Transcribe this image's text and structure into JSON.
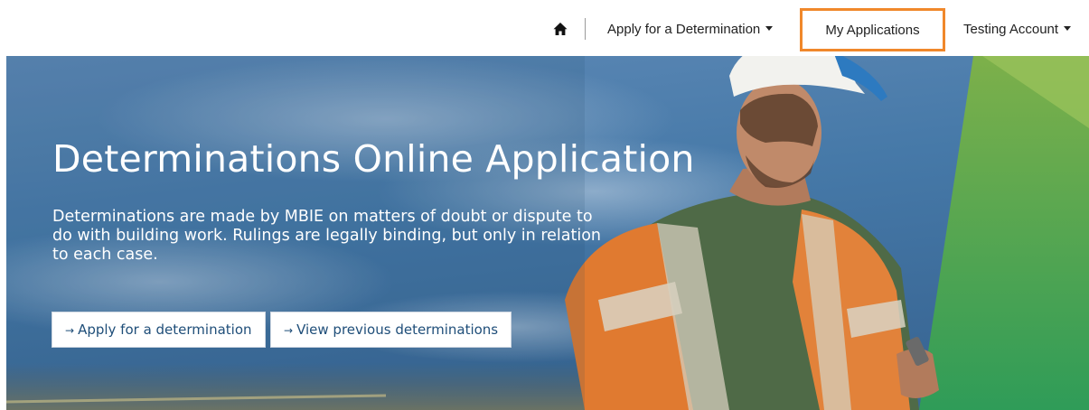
{
  "nav": {
    "home_icon": "home-icon",
    "apply_label": "Apply for a Determination",
    "my_applications_label": "My Applications",
    "account_label": "Testing Account",
    "highlight_color": "#f0882b"
  },
  "hero": {
    "title": "Determinations Online Application",
    "description": "Determinations are made by MBIE on matters of doubt or dispute to do with building work. Rulings are legally binding, but only in relation to each case.",
    "buttons": {
      "apply": {
        "arrow": "→",
        "label": "Apply for a determination"
      },
      "view": {
        "arrow": "→",
        "label": "View previous determinations"
      }
    }
  }
}
